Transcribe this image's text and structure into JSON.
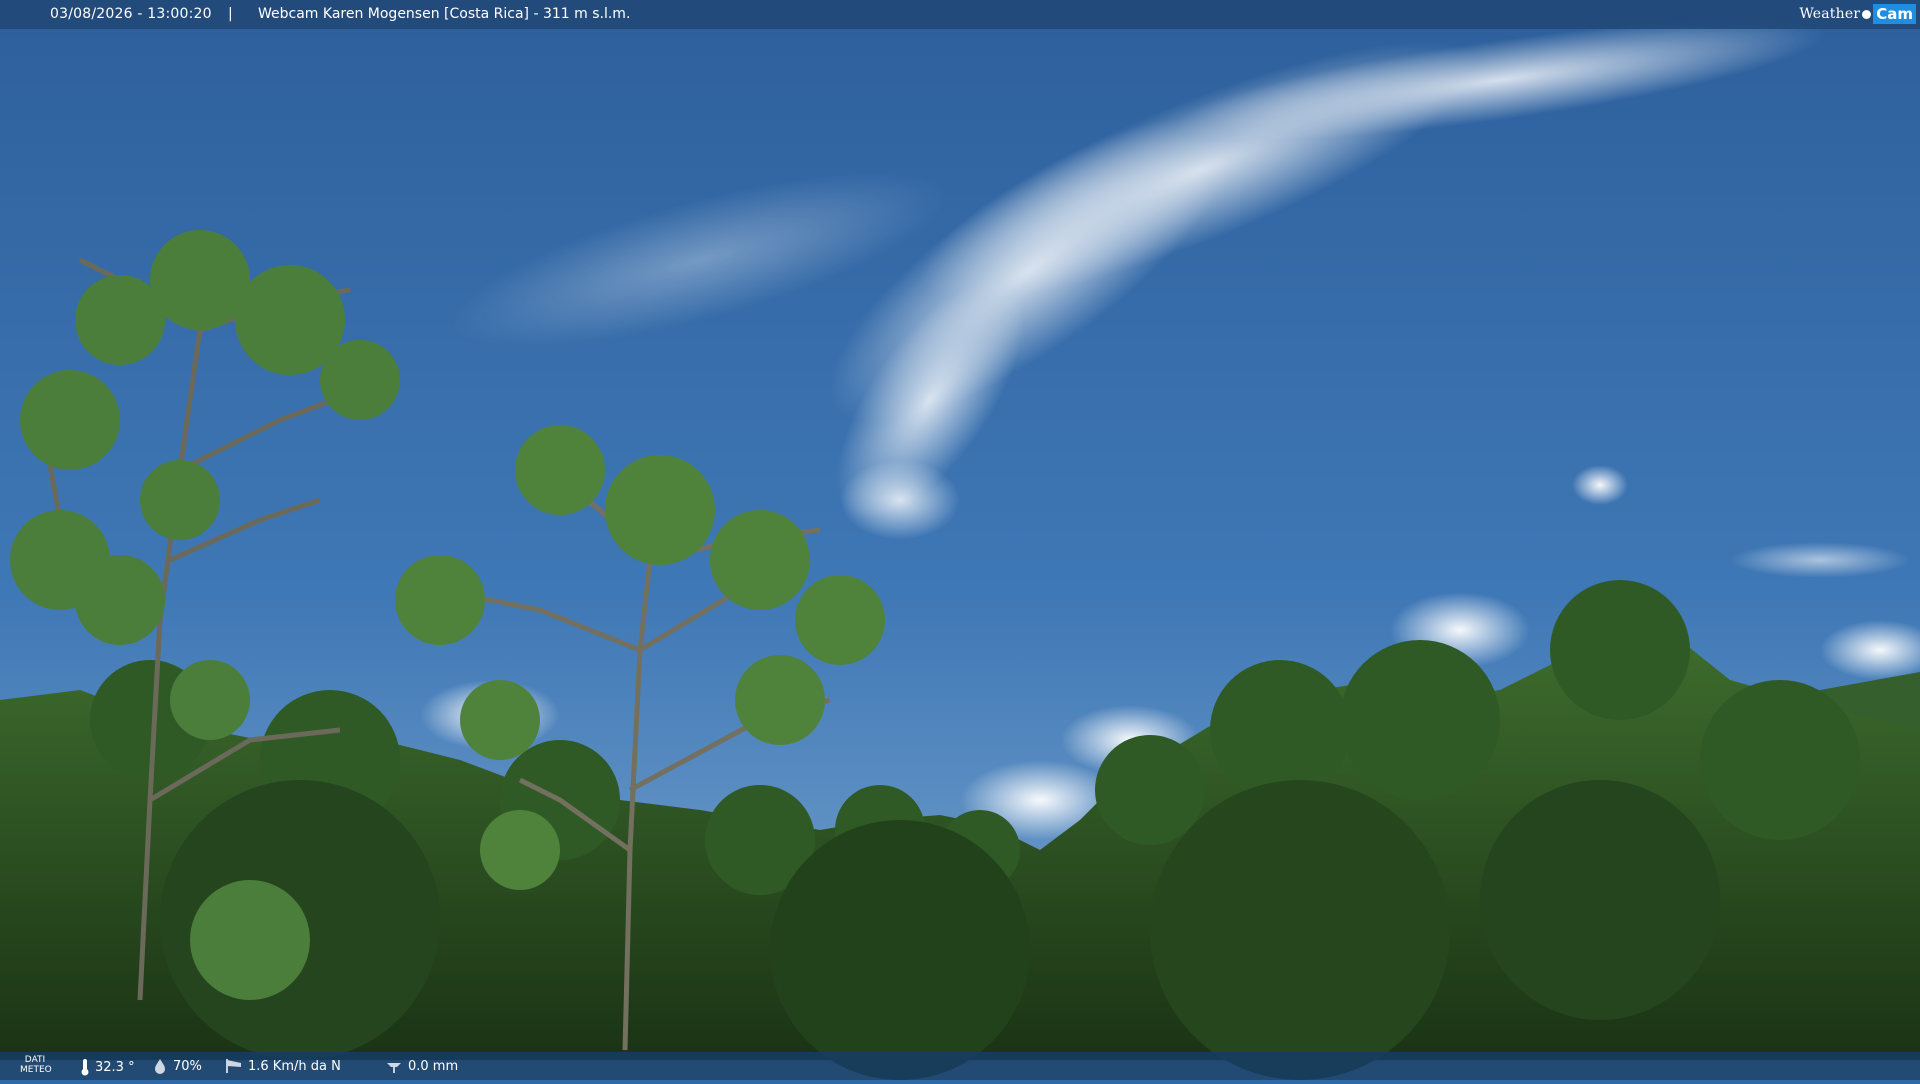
{
  "overlay": {
    "datetime": "03/08/2026 - 13:00:20",
    "separator": "|",
    "camera_title": "Webcam Karen Mogensen [Costa Rica]  - 311 m s.l.m."
  },
  "logo": {
    "word": "Weather",
    "badge": "Cam"
  },
  "weather": {
    "label_line1": "DATI",
    "label_line2": "METEO",
    "temperature": "32.3 °",
    "humidity": "70%",
    "wind": "1.6 Km/h da N",
    "rain": "0.0 mm"
  },
  "colors": {
    "sky_top": "#2d62a1",
    "sky_bottom": "#6b9ccc",
    "foliage_dark": "#1f3d1a",
    "foliage_mid": "#2e5a24",
    "foliage_light": "#4f7d3a",
    "logo_accent": "#1f8ee0"
  }
}
